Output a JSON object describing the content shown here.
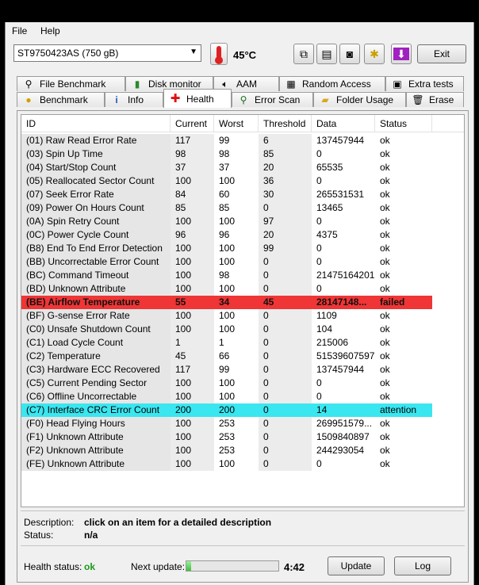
{
  "menu": {
    "file": "File",
    "help": "Help"
  },
  "toolbar": {
    "drive": "ST9750423AS (750 gB)",
    "temperature": "45°C",
    "exit_label": "Exit"
  },
  "tabs": {
    "row1": [
      "File Benchmark",
      "Disk monitor",
      "AAM",
      "Random Access",
      "Extra tests"
    ],
    "row2": [
      "Benchmark",
      "Info",
      "Health",
      "Error Scan",
      "Folder Usage",
      "Erase"
    ]
  },
  "columns": [
    "ID",
    "Current",
    "Worst",
    "Threshold",
    "Data",
    "Status"
  ],
  "rows": [
    [
      "(01) Raw Read Error Rate",
      "117",
      "99",
      "6",
      "137457944",
      "ok"
    ],
    [
      "(03) Spin Up Time",
      "98",
      "98",
      "85",
      "0",
      "ok"
    ],
    [
      "(04) Start/Stop Count",
      "37",
      "37",
      "20",
      "65535",
      "ok"
    ],
    [
      "(05) Reallocated Sector Count",
      "100",
      "100",
      "36",
      "0",
      "ok"
    ],
    [
      "(07) Seek Error Rate",
      "84",
      "60",
      "30",
      "265531531",
      "ok"
    ],
    [
      "(09) Power On Hours Count",
      "85",
      "85",
      "0",
      "13465",
      "ok"
    ],
    [
      "(0A) Spin Retry Count",
      "100",
      "100",
      "97",
      "0",
      "ok"
    ],
    [
      "(0C) Power Cycle Count",
      "96",
      "96",
      "20",
      "4375",
      "ok"
    ],
    [
      "(B8) End To End Error Detection",
      "100",
      "100",
      "99",
      "0",
      "ok"
    ],
    [
      "(BB) Uncorrectable Error Count",
      "100",
      "100",
      "0",
      "0",
      "ok"
    ],
    [
      "(BC) Command Timeout",
      "100",
      "98",
      "0",
      "21475164201",
      "ok"
    ],
    [
      "(BD) Unknown Attribute",
      "100",
      "100",
      "0",
      "0",
      "ok"
    ],
    [
      "(BE) Airflow Temperature",
      "55",
      "34",
      "45",
      "28147148...",
      "failed"
    ],
    [
      "(BF) G-sense Error Rate",
      "100",
      "100",
      "0",
      "1109",
      "ok"
    ],
    [
      "(C0) Unsafe Shutdown Count",
      "100",
      "100",
      "0",
      "104",
      "ok"
    ],
    [
      "(C1) Load Cycle Count",
      "1",
      "1",
      "0",
      "215006",
      "ok"
    ],
    [
      "(C2) Temperature",
      "45",
      "66",
      "0",
      "51539607597",
      "ok"
    ],
    [
      "(C3) Hardware ECC Recovered",
      "117",
      "99",
      "0",
      "137457944",
      "ok"
    ],
    [
      "(C5) Current Pending Sector",
      "100",
      "100",
      "0",
      "0",
      "ok"
    ],
    [
      "(C6) Offline Uncorrectable",
      "100",
      "100",
      "0",
      "0",
      "ok"
    ],
    [
      "(C7) Interface CRC Error Count",
      "200",
      "200",
      "0",
      "14",
      "attention"
    ],
    [
      "(F0) Head Flying Hours",
      "100",
      "253",
      "0",
      "269951579...",
      "ok"
    ],
    [
      "(F1) Unknown Attribute",
      "100",
      "253",
      "0",
      "1509840897",
      "ok"
    ],
    [
      "(F2) Unknown Attribute",
      "100",
      "253",
      "0",
      "244293054",
      "ok"
    ],
    [
      "(FE) Unknown Attribute",
      "100",
      "100",
      "0",
      "0",
      "ok"
    ]
  ],
  "description": {
    "label": "Description:",
    "value": "click on an item for a detailed description",
    "status_label": "Status:",
    "status_value": "n/a"
  },
  "footer": {
    "health_label": "Health status:",
    "health_value": "ok",
    "next_label": "Next update:",
    "timer": "4:42",
    "progress_fraction": 0.05,
    "update_label": "Update",
    "log_label": "Log"
  },
  "colors": {
    "failed": "#ef3535",
    "attention": "#3ae6f0",
    "ok_text": "#1a9a1a"
  }
}
